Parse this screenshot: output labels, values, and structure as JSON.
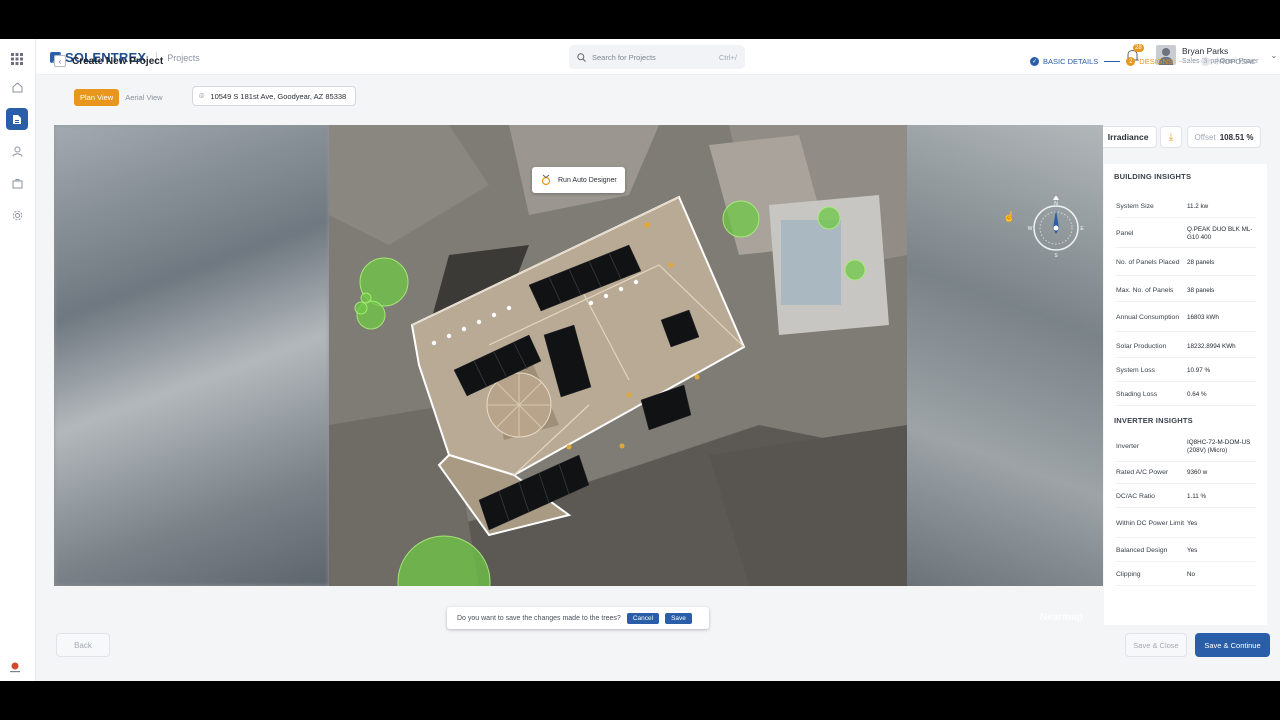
{
  "brand": {
    "name": "SOLENTREX",
    "crumb": "Projects"
  },
  "search": {
    "placeholder": "Search for Projects",
    "shortcut": "Ctrl+/"
  },
  "notifications": {
    "count": "28"
  },
  "user": {
    "name": "Bryan Parks",
    "role": "Sales Rep | Omni Power"
  },
  "page": {
    "title": "Create New Project"
  },
  "stepper": [
    {
      "label": "BASIC DETAILS",
      "state": "done",
      "num": "✓"
    },
    {
      "label": "DESIGNS",
      "state": "current",
      "num": "2"
    },
    {
      "label": "PROPOSAL",
      "state": "todo",
      "num": "3"
    }
  ],
  "view_toggle": {
    "plan": "Plan View",
    "aerial": "Aerial View"
  },
  "address": "10549 S 181st Ave, Goodyear, AZ 85338",
  "toolbar": {
    "irradiance": "Irradiance",
    "offset_label": "Offset",
    "offset_value": "108.51 %"
  },
  "map": {
    "auto_designer": "Run Auto Designer",
    "watermark": "Nearmap"
  },
  "confirm": {
    "question": "Do you want to save the changes made to the trees?",
    "cancel": "Cancel",
    "save": "Save"
  },
  "building_insights": {
    "title": "BUILDING INSIGHTS",
    "rows": [
      {
        "k": "System Size",
        "v": "11.2 kw"
      },
      {
        "k": "Panel",
        "v": "Q.PEAK DUO BLK ML-G10 400"
      },
      {
        "k": "No. of Panels Placed",
        "v": "28 panels"
      },
      {
        "k": "Max. No. of Panels",
        "v": "38 panels"
      },
      {
        "k": "Annual Consumption",
        "v": "16803 kWh"
      },
      {
        "k": "Solar Production",
        "v": "18232.8994 KWh"
      },
      {
        "k": "System Loss",
        "v": "10.97 %"
      },
      {
        "k": "Shading Loss",
        "v": "0.64 %"
      }
    ]
  },
  "inverter_insights": {
    "title": "INVERTER INSIGHTS",
    "rows": [
      {
        "k": "Inverter",
        "v": "IQ8HC-72-M-DOM-US (208V) (Micro)"
      },
      {
        "k": "Rated A/C Power",
        "v": "9360 w"
      },
      {
        "k": "DC/AC Ratio",
        "v": "1.11 %"
      },
      {
        "k": "Within DC Power Limit",
        "v": "Yes"
      },
      {
        "k": "Balanced Design",
        "v": "Yes"
      },
      {
        "k": "Clipping",
        "v": "No"
      }
    ]
  },
  "footer": {
    "back": "Back",
    "save_close": "Save & Close",
    "save_continue": "Save & Continue"
  },
  "colors": {
    "primary": "#2a5ea8",
    "accent": "#e8961c"
  }
}
